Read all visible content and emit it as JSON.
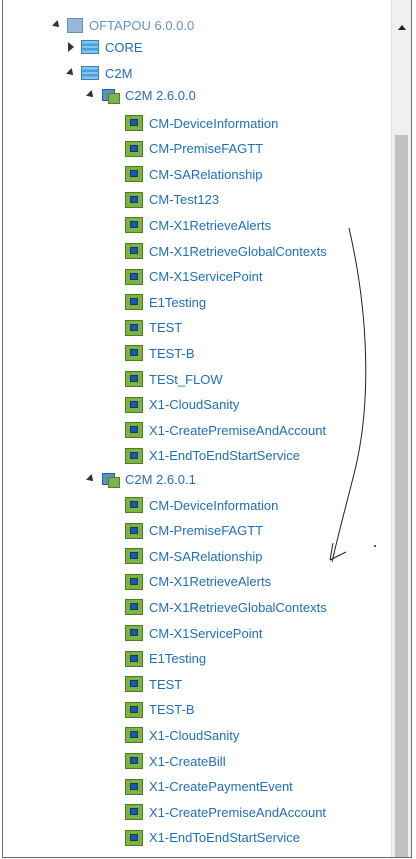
{
  "tree": {
    "root": {
      "label": "OFTAPOU 6.0.0.0",
      "icon": "project-icon",
      "expanded": true
    },
    "nodes": [
      {
        "label": "CORE",
        "icon": "database-icon",
        "expanded": false
      },
      {
        "label": "C2M",
        "icon": "database-icon",
        "expanded": true
      }
    ],
    "versions": [
      {
        "label": "C2M 2.6.0.0",
        "icon": "version-icon",
        "expanded": true,
        "items": [
          "CM-DeviceInformation",
          "CM-PremiseFAGTT",
          "CM-SARelationship",
          "CM-Test123",
          "CM-X1RetrieveAlerts",
          "CM-X1RetrieveGlobalContexts",
          "CM-X1ServicePoint",
          "E1Testing",
          "TEST",
          "TEST-B",
          "TESt_FLOW",
          "X1-CloudSanity",
          "X1-CreatePremiseAndAccount",
          "X1-EndToEndStartService"
        ]
      },
      {
        "label": "C2M 2.6.0.1",
        "icon": "version-icon",
        "expanded": true,
        "items": [
          "CM-DeviceInformation",
          "CM-PremiseFAGTT",
          "CM-SARelationship",
          "CM-X1RetrieveAlerts",
          "CM-X1RetrieveGlobalContexts",
          "CM-X1ServicePoint",
          "E1Testing",
          "TEST",
          "TEST-B",
          "X1-CloudSanity",
          "X1-CreateBill",
          "X1-CreatePaymentEvent",
          "X1-CreatePremiseAndAccount",
          "X1-EndToEndStartService"
        ]
      }
    ],
    "flow_icon": "flow-icon"
  },
  "colors": {
    "link": "#1f6fb8",
    "root_label": "#5f93c8",
    "scrollbar_track": "#f0f0f0",
    "scrollbar_thumb": "#c1c1c1"
  }
}
